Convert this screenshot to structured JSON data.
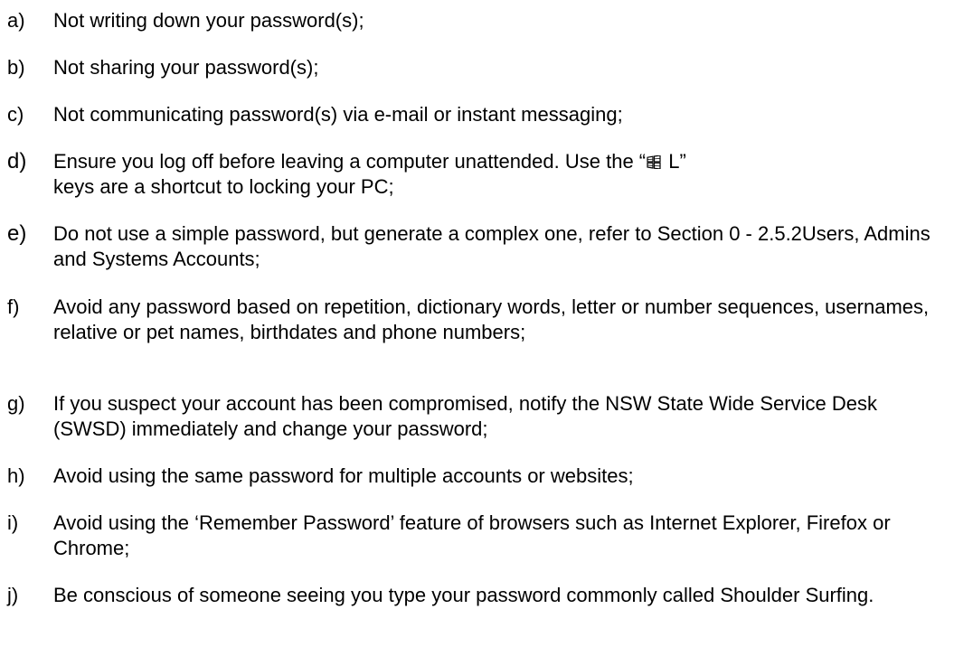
{
  "list": {
    "items": [
      {
        "marker": "a)",
        "text": "Not writing down your password(s);"
      },
      {
        "marker": "b)",
        "text": "Not sharing your password(s);"
      },
      {
        "marker": "c)",
        "text": "Not communicating password(s) via e-mail or instant messaging;"
      },
      {
        "marker": "d)",
        "text_before": "Ensure you log off before leaving a computer unattended. Use the “",
        "text_after": " L”",
        "line2": "keys are a shortcut to locking your PC;",
        "icon": "windows-key-icon"
      },
      {
        "marker": "e)",
        "text": "Do not use a simple password, but generate a complex one, refer to Section 0 - 2.5.2Users, Admins and Systems Accounts;"
      },
      {
        "marker": "f)",
        "text": "Avoid any password based on repetition, dictionary words, letter or number sequences, usernames, relative or pet names, birthdates and phone numbers;"
      },
      {
        "marker": "g)",
        "text": "If you suspect your account has been compromised, notify the NSW State Wide Service Desk (SWSD) immediately and change your password;"
      },
      {
        "marker": "h)",
        "text": "Avoid using the same password for multiple accounts or websites;"
      },
      {
        "marker": "i)",
        "text": "Avoid using the ‘Remember Password’ feature of browsers such as Internet Explorer, Firefox or Chrome;"
      },
      {
        "marker": "j)",
        "text": "Be conscious of someone seeing you type your password commonly called Shoulder Surfing."
      }
    ]
  }
}
